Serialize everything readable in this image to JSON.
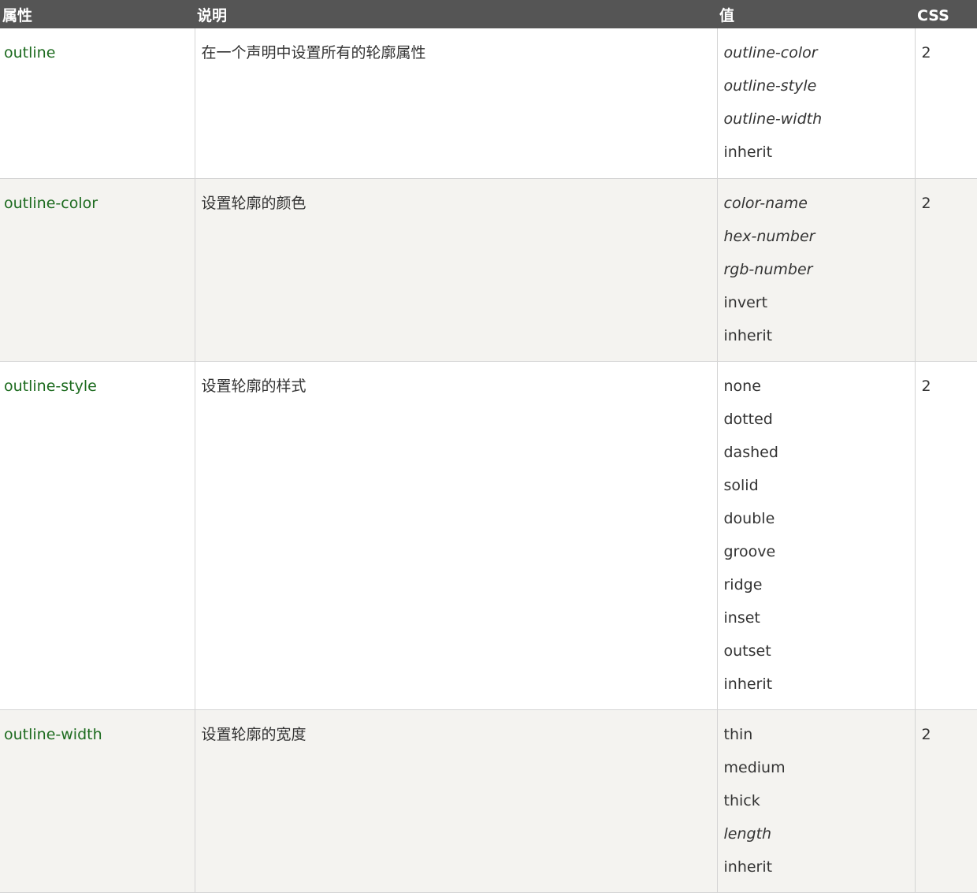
{
  "headers": [
    "属性",
    "说明",
    "值",
    "CSS"
  ],
  "rows": [
    {
      "property": "outline",
      "description": "在一个声明中设置所有的轮廓属性",
      "values": [
        {
          "text": "outline-color",
          "italic": true
        },
        {
          "text": "outline-style",
          "italic": true
        },
        {
          "text": "outline-width",
          "italic": true
        },
        {
          "text": "inherit",
          "italic": false
        }
      ],
      "css": "2"
    },
    {
      "property": "outline-color",
      "description": "设置轮廓的颜色",
      "values": [
        {
          "text": "color-name",
          "italic": true
        },
        {
          "text": "hex-number",
          "italic": true
        },
        {
          "text": "rgb-number",
          "italic": true
        },
        {
          "text": "invert",
          "italic": false
        },
        {
          "text": "inherit",
          "italic": false
        }
      ],
      "css": "2"
    },
    {
      "property": "outline-style",
      "description": "设置轮廓的样式",
      "values": [
        {
          "text": "none",
          "italic": false
        },
        {
          "text": "dotted",
          "italic": false
        },
        {
          "text": "dashed",
          "italic": false
        },
        {
          "text": "solid",
          "italic": false
        },
        {
          "text": "double",
          "italic": false
        },
        {
          "text": "groove",
          "italic": false
        },
        {
          "text": "ridge",
          "italic": false
        },
        {
          "text": "inset",
          "italic": false
        },
        {
          "text": "outset",
          "italic": false
        },
        {
          "text": "inherit",
          "italic": false
        }
      ],
      "css": "2"
    },
    {
      "property": "outline-width",
      "description": "设置轮廓的宽度",
      "values": [
        {
          "text": "thin",
          "italic": false
        },
        {
          "text": "medium",
          "italic": false
        },
        {
          "text": "thick",
          "italic": false
        },
        {
          "text": "length",
          "italic": true
        },
        {
          "text": "inherit",
          "italic": false
        }
      ],
      "css": "2"
    }
  ],
  "colors": {
    "header_bg": "#555555",
    "link": "#1d6b1f",
    "alt_row_bg": "#f4f3f0"
  }
}
